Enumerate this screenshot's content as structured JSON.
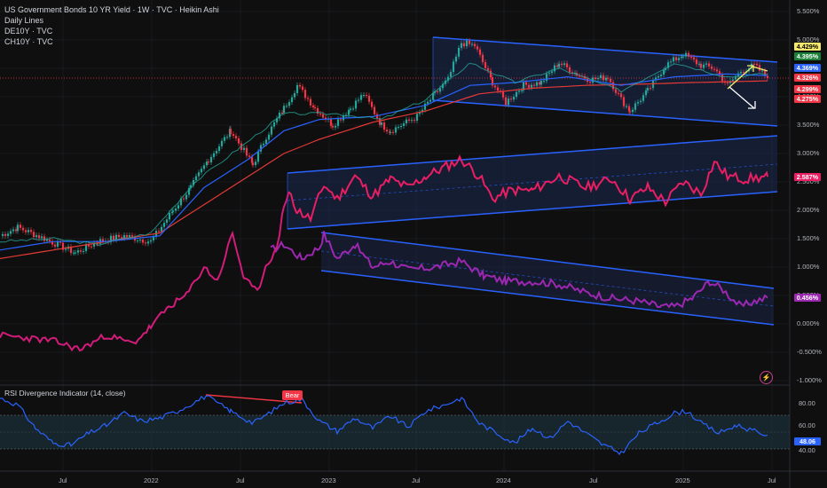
{
  "legend": {
    "title": "US Government Bonds 10 YR Yield · 1W · TVC · Heikin Ashi",
    "line1": "Daily Lines",
    "line2": "DE10Y · TVC",
    "line3": "CH10Y · TVC"
  },
  "y_axis_ticks": [
    "5.500%",
    "5.000%",
    "4.500%",
    "4.000%",
    "3.500%",
    "3.000%",
    "2.500%",
    "2.000%",
    "1.500%",
    "1.000%",
    "0.500%",
    "0.000%",
    "-0.500%",
    "-1.000%"
  ],
  "x_axis_ticks": [
    "Jul",
    "2022",
    "Jul",
    "2023",
    "Jul",
    "2024",
    "Jul",
    "2025",
    "Jul"
  ],
  "price_tags": [
    {
      "text": "4.429%",
      "bg": "#f5e86a",
      "fg": "#000000"
    },
    {
      "text": "4.395%",
      "bg": "#1a7f37",
      "fg": "#ffffff"
    },
    {
      "text": "4.369%",
      "bg": "#2962ff",
      "fg": "#ffffff"
    },
    {
      "text": "4.326%",
      "bg": "#f23645",
      "fg": "#ffffff"
    },
    {
      "text": "4.299%",
      "bg": "#f23645",
      "fg": "#ffffff"
    },
    {
      "text": "4.275%",
      "bg": "#f23645",
      "fg": "#ffffff"
    }
  ],
  "de_tag": {
    "text": "2.587%",
    "bg": "#e91e63",
    "fg": "#ffffff"
  },
  "ch_tag": {
    "text": "0.456%",
    "bg": "#9c27b0",
    "fg": "#ffffff"
  },
  "rsi": {
    "title": "RSI Divergence Indicator (14, close)",
    "bear_label": "Bear",
    "ticks": [
      "80.00",
      "60.00",
      "40.00"
    ],
    "value_tag": {
      "text": "48.06",
      "bg": "#2962ff",
      "fg": "#ffffff"
    }
  },
  "icons": {
    "lightning": "lightning-icon"
  },
  "colors": {
    "us": "#26a69a",
    "down": "#f23645",
    "de": "#e91e63",
    "ch": "#9c27b0",
    "rsi": "#2962ff",
    "channel": "#2962ff"
  },
  "chart_data": {
    "type": "line",
    "x": [
      "Jul 2021",
      "2022",
      "Jul 2022",
      "2023",
      "Jul 2023",
      "2024",
      "Jul 2024",
      "2025",
      "Jul 2025"
    ],
    "ylim": [
      -1.0,
      5.5
    ],
    "series": [
      {
        "name": "US Government Bonds 10 YR Yield",
        "values": [
          1.35,
          1.75,
          2.9,
          3.75,
          3.9,
          4.0,
          4.3,
          4.55,
          4.33
        ]
      },
      {
        "name": "DE10Y",
        "values": [
          -0.25,
          -0.1,
          1.2,
          2.4,
          2.5,
          2.05,
          2.5,
          2.4,
          2.59
        ]
      },
      {
        "name": "CH10Y",
        "values": [
          -0.3,
          -0.1,
          0.9,
          1.5,
          1.0,
          0.8,
          0.4,
          0.35,
          0.46
        ]
      }
    ],
    "rsi": {
      "ylim": [
        20,
        90
      ],
      "levels": [
        70,
        30
      ]
    }
  }
}
